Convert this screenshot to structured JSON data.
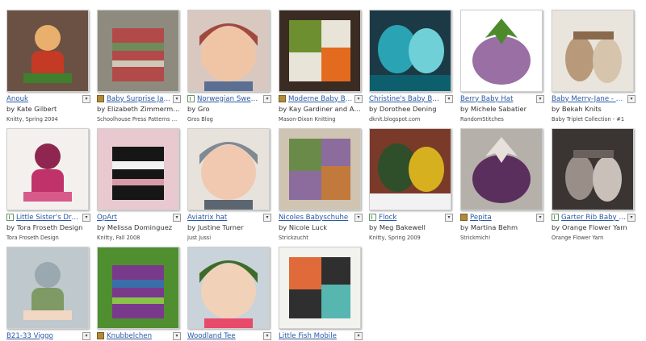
{
  "patterns": [
    {
      "title": "Anouk",
      "author": "by Kate Gilbert",
      "source": "Knitty, Spring 2004",
      "icon": "none",
      "colors": [
        "#6b5144",
        "#c43a24",
        "#3f7f2e",
        "#e9b06d"
      ]
    },
    {
      "title": "Baby Surprise Jacket",
      "author": "by Elizabeth Zimmerma…",
      "source": "Schoolhouse Press Patterns …",
      "icon": "pdf",
      "colors": [
        "#8e8a7e",
        "#b24a4a",
        "#6e8c5a",
        "#cfc7b7"
      ]
    },
    {
      "title": "Norwegian Sweet Ba…",
      "author": "by Gro",
      "source": "Gros Blog",
      "icon": "free",
      "colors": [
        "#d9c8bf",
        "#a0493e",
        "#f0c5a6",
        "#5a6f92"
      ]
    },
    {
      "title": "Moderne Baby Blanket",
      "author": "by Kay Gardiner and An…",
      "source": "Mason-Dixon Knitting",
      "icon": "pdf",
      "colors": [
        "#3a2b23",
        "#e36b1f",
        "#6d8f2f",
        "#e8e4d8"
      ]
    },
    {
      "title": "Christine's Baby Booties",
      "author": "by Dorothee Dening",
      "source": "dknit.blogspot.com",
      "icon": "none",
      "colors": [
        "#0d5f6e",
        "#2aa3b4",
        "#6fd0d8",
        "#1c3a46"
      ]
    },
    {
      "title": "Berry Baby Hat",
      "author": "by Michele Sabatier",
      "source": "RandomStitches",
      "icon": "none",
      "colors": [
        "#ffffff",
        "#9a6fa3",
        "#4d8a2c",
        "#c6a8c9"
      ]
    },
    {
      "title": "Baby Merry-Jane - Booti…",
      "author": "by Bekah Knits",
      "source": "Baby Triplet Collection - #1",
      "icon": "none",
      "colors": [
        "#e9e4dc",
        "#b89a7a",
        "#8a6a4c",
        "#d6c4ad"
      ]
    },
    {
      "title": "Little Sister's Dress (…",
      "author": "by Tora Froseth Design",
      "source": "Tora Froseth Design",
      "icon": "free",
      "colors": [
        "#f4f0ee",
        "#c0336a",
        "#d85a8a",
        "#8f2650"
      ]
    },
    {
      "title": "OpArt",
      "author": "by Melissa Dominguez",
      "source": "Knitty, Fall 2008",
      "icon": "none",
      "colors": [
        "#e7c9cf",
        "#161616",
        "#f2f2f2",
        "#d89aa6"
      ]
    },
    {
      "title": "Aviatrix hat",
      "author": "by Justine Turner",
      "source": "Just Jussi",
      "icon": "none",
      "colors": [
        "#e8e2dd",
        "#7f8a93",
        "#f1c9b0",
        "#5b6670"
      ]
    },
    {
      "title": "Nicoles Babyschuhe",
      "author": "by Nicole Luck",
      "source": "Strickzucht",
      "icon": "none",
      "colors": [
        "#cfc3b1",
        "#c27a3c",
        "#6a8a4a",
        "#8b6c9c"
      ]
    },
    {
      "title": "Flock",
      "author": "by Meg Bakewell",
      "source": "Knitty, Spring 2009",
      "icon": "free",
      "colors": [
        "#f2f2f2",
        "#2e4f2a",
        "#d7b020",
        "#7a3a2a"
      ]
    },
    {
      "title": "Pepita",
      "author": "by Martina Behm",
      "source": "Strickmich!",
      "icon": "pdf",
      "colors": [
        "#b6b0aa",
        "#5a2f5e",
        "#e8e0da",
        "#3a3a3a"
      ]
    },
    {
      "title": "Garter Rib Baby Blan…",
      "author": "by Orange Flower Yarn",
      "source": "Orange Flower Yarn",
      "icon": "free",
      "colors": [
        "#3a3432",
        "#9a8e88",
        "#6a605c",
        "#c9c0ba"
      ]
    },
    {
      "title": "B21-33 Viggo",
      "author": "",
      "source": "",
      "icon": "none",
      "colors": [
        "#bfc8cc",
        "#7f9a64",
        "#f0d8c4",
        "#9aa8b0"
      ]
    },
    {
      "title": "Knubbelchen",
      "author": "",
      "source": "",
      "icon": "pdf",
      "colors": [
        "#4f8f2f",
        "#7a3a8c",
        "#3a6ea8",
        "#8bc34a"
      ]
    },
    {
      "title": "Woodland Tee",
      "author": "",
      "source": "",
      "icon": "none",
      "colors": [
        "#c9d3d9",
        "#3e6b2a",
        "#f2d1b9",
        "#e84a6a"
      ]
    },
    {
      "title": "Little Fish Mobile",
      "author": "",
      "source": "",
      "icon": "none",
      "colors": [
        "#f2f2ee",
        "#58b6b0",
        "#e06a3a",
        "#2f2f2f"
      ]
    }
  ]
}
